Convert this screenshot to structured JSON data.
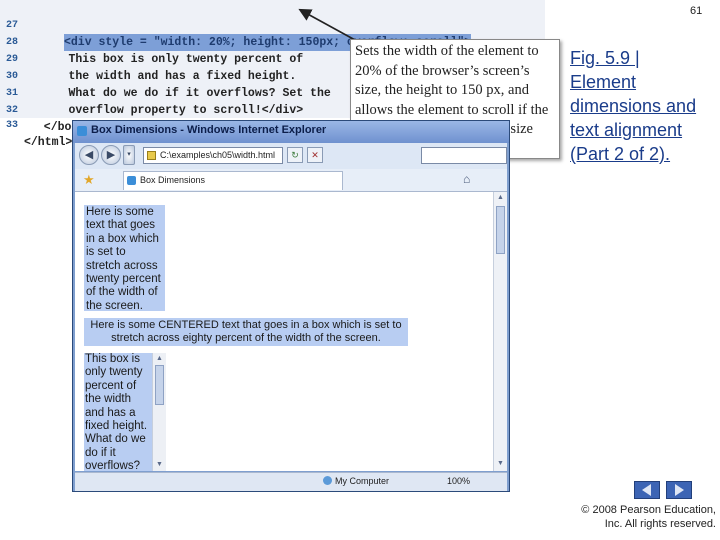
{
  "page_number": "61",
  "code_lines": [
    {
      "num": "27",
      "text": "<div style = \"width: 20%; height: 150px; overflow: scroll\">",
      "highlight": true
    },
    {
      "num": "28",
      "text": "     This box is only twenty percent of",
      "highlight": false
    },
    {
      "num": "29",
      "text": "     the width and has a fixed height.",
      "highlight": false
    },
    {
      "num": "30",
      "text": "     What do we do if it overflows? Set the",
      "highlight": false
    },
    {
      "num": "31",
      "text": "     overflow property to scroll!</div>",
      "highlight": false
    },
    {
      "num": "32",
      "text": "  </body>",
      "highlight": false
    },
    {
      "num": "33",
      "text": "</html>",
      "highlight": false
    }
  ],
  "callout": "Sets the width of the element to 20% of the browser’s screen’s size, the height to 150 px, and allows the element to scroll if the text overflows the allotted size",
  "caption": {
    "fig": "Fig. 5.9 |",
    "text": "Element dimensions and text alignment (Part 2 of 2)."
  },
  "browser": {
    "title": "Box Dimensions - Windows Internet Explorer",
    "address": "C:\\examples\\ch05\\width.html",
    "tab_label": "Box Dimensions",
    "box1_text": "Here is some text that goes in a box which is set to stretch across twenty percent of the width of the screen.",
    "box2_text": "Here is some CENTERED text that goes in a box which is set to stretch across eighty percent of the width of the screen.",
    "box3_text": "This box is only twenty percent of the width and has a fixed height. What do we do if it overflows?",
    "status_zone": "My Computer",
    "status_zoom": "100%"
  },
  "copyright": "© 2008 Pearson Education, Inc.  All rights reserved.",
  "colors": {
    "highlight": "#7d9fd7",
    "box_fill": "#b8cdf2",
    "caption": "#1a3c8a"
  },
  "icons": [
    "back-arrow-icon",
    "forward-arrow-icon",
    "refresh-icon",
    "stop-icon",
    "favorites-star-icon",
    "home-icon",
    "globe-icon",
    "prev-slide-icon",
    "next-slide-icon"
  ]
}
